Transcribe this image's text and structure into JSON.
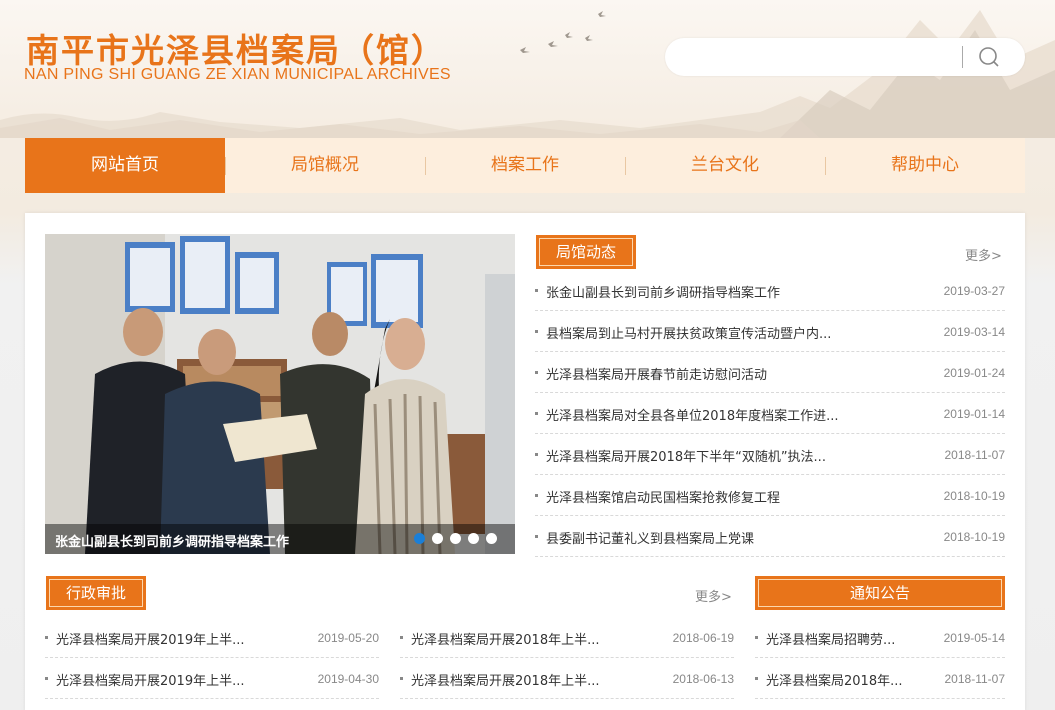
{
  "header": {
    "title_cn": "南平市光泽县档案局（馆）",
    "title_en": "NAN PING SHI GUANG ZE XIAN  MUNICIPAL  ARCHIVES",
    "search": {
      "value": "",
      "placeholder": ""
    }
  },
  "nav": {
    "items": [
      {
        "label": "网站首页"
      },
      {
        "label": "局馆概况"
      },
      {
        "label": "档案工作"
      },
      {
        "label": "兰台文化"
      },
      {
        "label": "帮助中心"
      }
    ]
  },
  "slider": {
    "caption": "张金山副县长到司前乡调研指导档案工作",
    "total": 5,
    "active": 1
  },
  "news": {
    "heading": "局馆动态",
    "more": "更多>",
    "items": [
      {
        "title": "张金山副县长到司前乡调研指导档案工作",
        "date": "2019-03-27"
      },
      {
        "title": "县档案局到止马村开展扶贫政策宣传活动暨户内...",
        "date": "2019-03-14"
      },
      {
        "title": "光泽县档案局开展春节前走访慰问活动",
        "date": "2019-01-24"
      },
      {
        "title": "光泽县档案局对全县各单位2018年度档案工作进...",
        "date": "2019-01-14"
      },
      {
        "title": "光泽县档案局开展2018年下半年“双随机”执法...",
        "date": "2018-11-07"
      },
      {
        "title": "光泽县档案馆启动民国档案抢救修复工程",
        "date": "2018-10-19"
      },
      {
        "title": "县委副书记董礼义到县档案局上党课",
        "date": "2018-10-19"
      }
    ]
  },
  "admin": {
    "heading": "行政审批",
    "more": "更多>",
    "col1": [
      {
        "title": "光泽县档案局开展2019年上半...",
        "date": "2019-05-20"
      },
      {
        "title": "光泽县档案局开展2019年上半...",
        "date": "2019-04-30"
      }
    ],
    "col2": [
      {
        "title": "光泽县档案局开展2018年上半...",
        "date": "2018-06-19"
      },
      {
        "title": "光泽县档案局开展2018年上半...",
        "date": "2018-06-13"
      }
    ]
  },
  "notice": {
    "heading": "通知公告",
    "items": [
      {
        "title": "光泽县档案局招聘劳...",
        "date": "2019-05-14"
      },
      {
        "title": "光泽县档案局2018年...",
        "date": "2018-11-07"
      }
    ]
  },
  "colors": {
    "accent": "#e8741a",
    "nav_bg": "#fdeedd",
    "dot_active": "#1a7fd8"
  }
}
